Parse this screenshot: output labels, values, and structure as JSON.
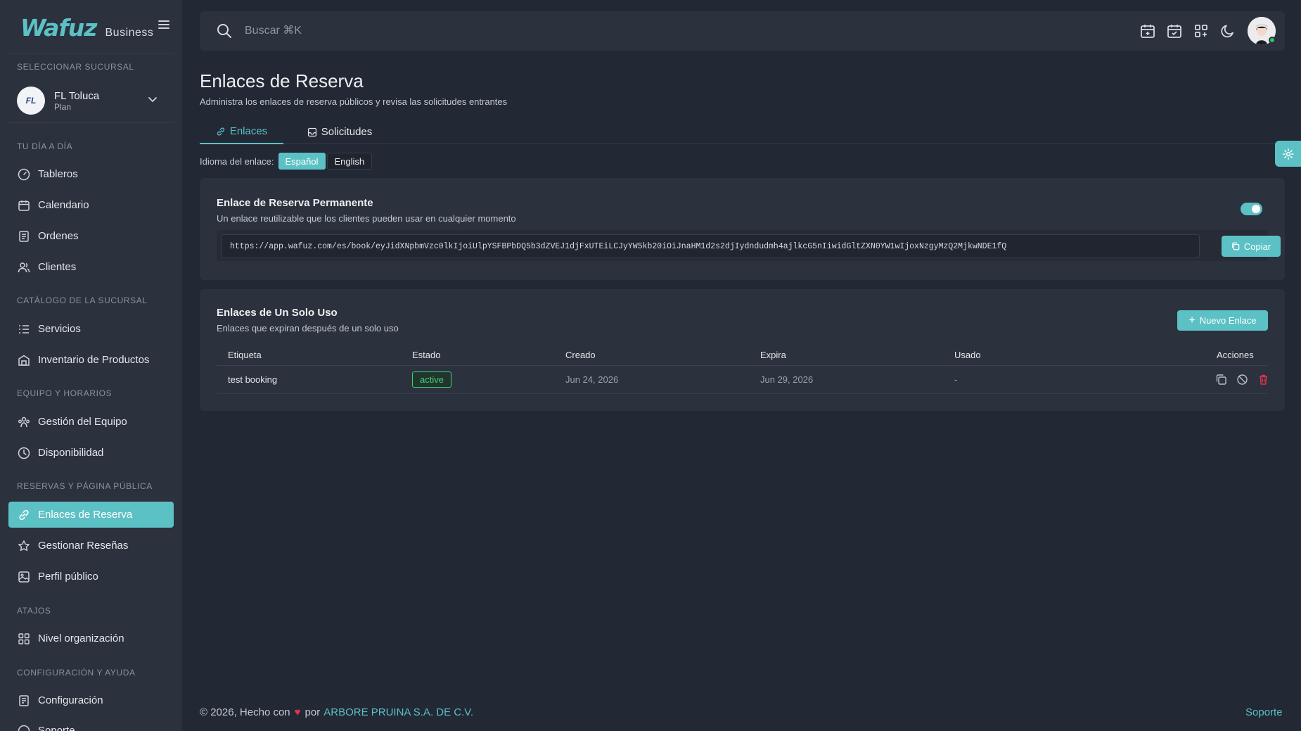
{
  "brand": {
    "name": "Wafuz",
    "sub": "Business"
  },
  "sidebar": {
    "select_branch_label": "SELECCIONAR SUCURSAL",
    "branch": {
      "name": "FL Toluca",
      "plan": "Plan",
      "avatar_text": "FL"
    },
    "sections": {
      "daily": "TU DÍA A DÍA",
      "catalog": "CATÁLOGO DE LA SUCURSAL",
      "team": "EQUIPO Y HORARIOS",
      "bookings": "RESERVAS Y PÁGINA PÚBLICA",
      "shortcuts": "ATAJOS",
      "config": "CONFIGURACIÓN Y AYUDA"
    },
    "items": {
      "tableros": "Tableros",
      "calendario": "Calendario",
      "ordenes": "Ordenes",
      "clientes": "Clientes",
      "servicios": "Servicios",
      "inventario": "Inventario de Productos",
      "gestion_equipo": "Gestión del Equipo",
      "disponibilidad": "Disponibilidad",
      "enlaces": "Enlaces de Reserva",
      "resenas": "Gestionar Reseñas",
      "perfil": "Perfil público",
      "nivel": "Nivel organización",
      "configuracion": "Configuración",
      "soporte": "Soporte"
    }
  },
  "search": {
    "placeholder": "Buscar ⌘K"
  },
  "page": {
    "title": "Enlaces de Reserva",
    "subtitle": "Administra los enlaces de reserva públicos y revisa las solicitudes entrantes"
  },
  "tabs": {
    "enlaces": "Enlaces",
    "solicitudes": "Solicitudes"
  },
  "language": {
    "label": "Idioma del enlace:",
    "spanish": "Español",
    "english": "English",
    "selected": "Español"
  },
  "permanent": {
    "title": "Enlace de Reserva Permanente",
    "subtitle": "Un enlace reutilizable que los clientes pueden usar en cualquier momento",
    "enabled": true,
    "url": "https://app.wafuz.com/es/book/eyJidXNpbmVzc0lkIjoiUlpYSFBPbDQ5b3dZVEJ1djFxUTEiLCJyYW5kb20iOiJnaHM1d2s2djIydndudmh4ajlkcG5nIiwidGltZXN0YW1wIjoxNzgyMzQ2MjkwNDE1fQ",
    "copy_label": "Copiar"
  },
  "single_use": {
    "title": "Enlaces de Un Solo Uso",
    "subtitle": "Enlaces que expiran después de un solo uso",
    "new_label": "Nuevo Enlace",
    "columns": {
      "label": "Etiqueta",
      "status": "Estado",
      "created": "Creado",
      "expires": "Expira",
      "used": "Usado",
      "actions": "Acciones"
    },
    "rows": [
      {
        "label": "test booking",
        "status": "active",
        "created": "Jun 24, 2026",
        "expires": "Jun 29, 2026",
        "used": "-"
      }
    ]
  },
  "footer": {
    "prefix": "© 2026, Hecho con",
    "by": "por",
    "company": "ARBORE PRUINA S.A. DE C.V.",
    "support": "Soporte"
  },
  "colors": {
    "accent": "#5cc1c5",
    "sidebar": "#2b313d",
    "background": "#222834",
    "success": "#3fd07a",
    "danger": "#e0364f"
  }
}
